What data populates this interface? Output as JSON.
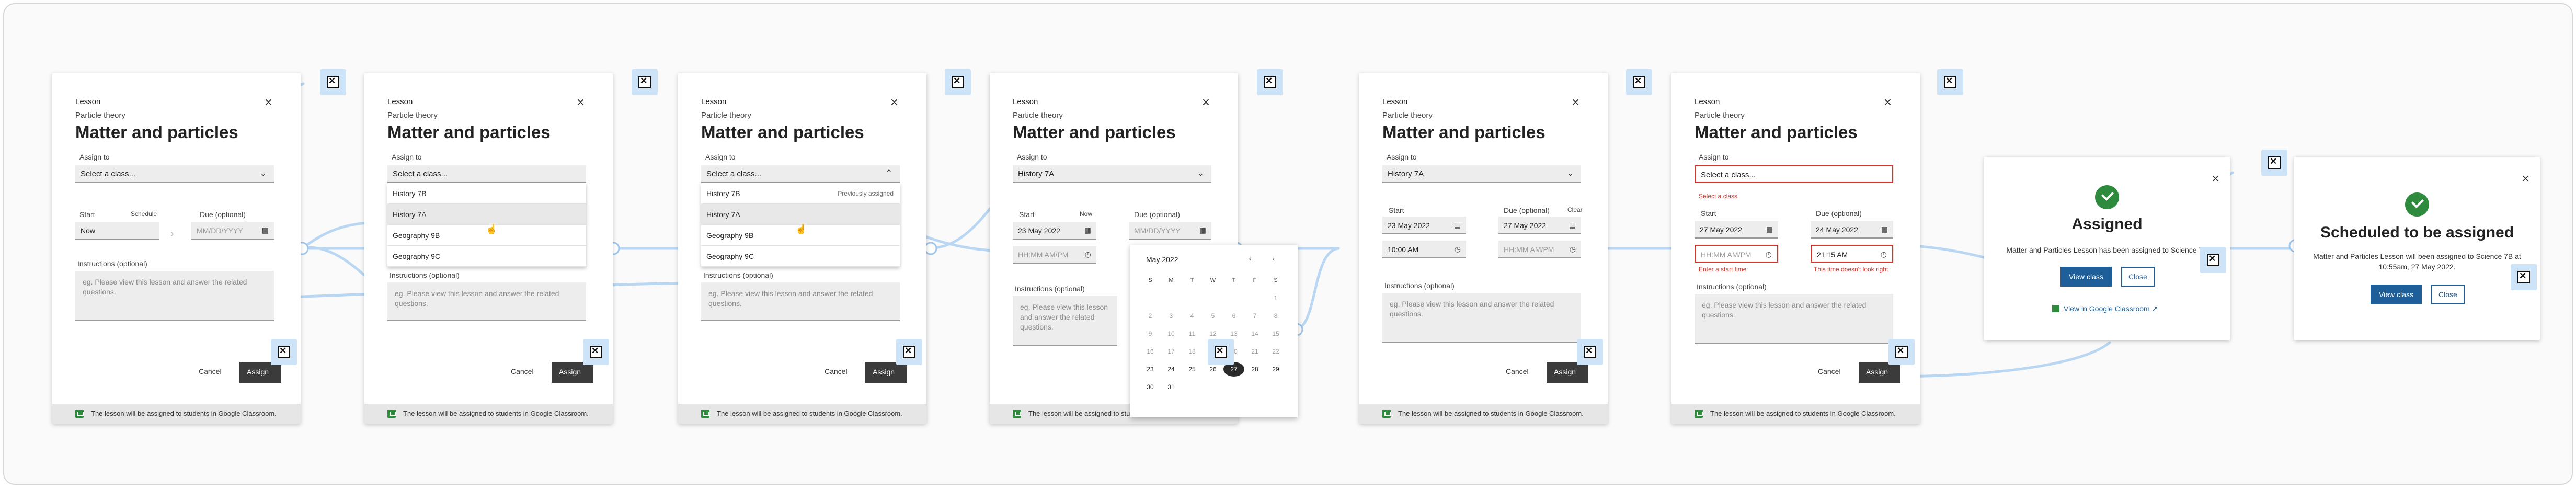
{
  "lesson": {
    "type_label": "Lesson",
    "subject": "Particle theory",
    "title": "Matter and particles",
    "assign_to_label": "Assign to",
    "select_placeholder": "Select a class...",
    "select_error": "Select a class",
    "start_label": "Start",
    "schedule_link": "Schedule",
    "now_link": "Now",
    "clear_link": "Clear",
    "start_now_value": "Now",
    "due_label": "Due (optional)",
    "date_placeholder": "MM/DD/YYYY",
    "time_placeholder": "HH:MM AM/PM",
    "instructions_label": "Instructions (optional)",
    "instructions_placeholder": "eg. Please view this lesson and answer the related questions.",
    "cancel_label": "Cancel",
    "assign_label": "Assign",
    "footer_text": "The lesson will be assigned to students in Google Classroom.",
    "close_glyph": "×"
  },
  "dropdown_options": [
    "History 7B",
    "History 7A",
    "Geography 9B",
    "Geography 9C"
  ],
  "previously_assigned_note": "Previously assigned",
  "values": {
    "class_selected": "History 7A",
    "start_date": "23 May 2022",
    "start_time": "10:00 AM",
    "due_date": "27 May 2022",
    "due_date_b": "24 May 2022",
    "due_time_b": "21:15 AM",
    "start_date_b": "27 May 2022"
  },
  "errors": {
    "start_time_missing": "Enter a start time",
    "time_invalid": "This time doesn't look right"
  },
  "calendar": {
    "month": "May 2022",
    "weekdays": [
      "S",
      "M",
      "T",
      "W",
      "T",
      "F",
      "S"
    ],
    "days": [
      "",
      "",
      "",
      "",
      "",
      "",
      "1",
      "2",
      "3",
      "4",
      "5",
      "6",
      "7",
      "8",
      "9",
      "10",
      "11",
      "12",
      "13",
      "14",
      "15",
      "16",
      "17",
      "18",
      "19",
      "20",
      "21",
      "22",
      "23",
      "24",
      "25",
      "26",
      "27",
      "28",
      "29",
      "30",
      "31",
      "",
      "",
      ""
    ],
    "selected_day": "27",
    "nav": "‹ ›"
  },
  "confirm_assigned": {
    "title": "Assigned",
    "message": "Matter and Particles Lesson has been assigned to Science 7B",
    "view_label": "View class",
    "close_label": "Close",
    "gc_link": "View in Google Classroom ↗"
  },
  "confirm_scheduled": {
    "title": "Scheduled to be assigned",
    "message": "Matter and Particles Lesson will been assigned to Science 7B at 10:55am, 27 May 2022.",
    "view_label": "View class",
    "close_label": "Close"
  },
  "icons": [
    "close-icon",
    "chevron-down-icon",
    "chevron-up-icon",
    "calendar-icon",
    "clock-icon",
    "check-icon",
    "google-classroom-icon",
    "annotation-x-icon",
    "cursor-icon"
  ],
  "colors": {
    "flow_line": "#b9d7f3",
    "accent": "#1f5f99",
    "error": "#d9342b",
    "success": "#2e8b3d"
  }
}
